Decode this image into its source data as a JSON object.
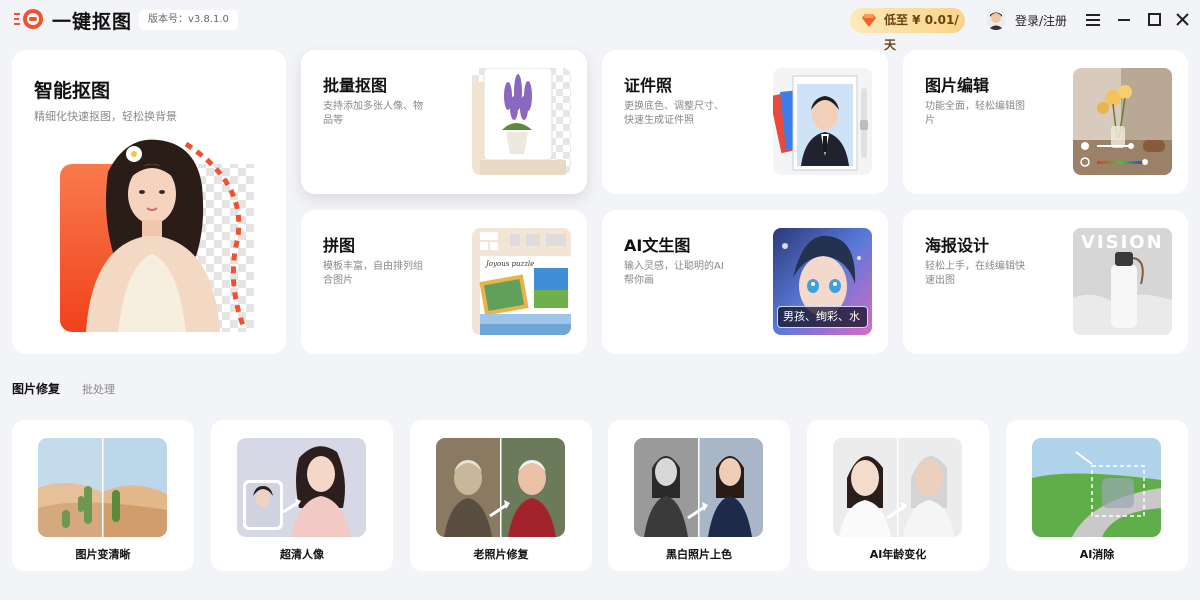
{
  "app": {
    "title": "一键抠图",
    "version": "版本号：v3.8.1.0"
  },
  "header": {
    "promo_label": "低至 ¥ 0.01/天",
    "login_label": "登录/注册"
  },
  "featured": {
    "title": "智能抠图",
    "desc": "精细化快速抠图，轻松换背景"
  },
  "tools": [
    {
      "title": "批量抠图",
      "desc": "支持添加多张人像、物品等"
    },
    {
      "title": "证件照",
      "desc": "更换底色、调整尺寸、快速生成证件照"
    },
    {
      "title": "图片编辑",
      "desc": "功能全面，轻松编辑图片"
    },
    {
      "title": "拼图",
      "desc": "模板丰富，自由排列组合图片"
    },
    {
      "title": "AI文生图",
      "desc": "输入灵感，让聪明的AI帮你画",
      "prompt_example": "男孩、绚彩、水"
    },
    {
      "title": "海报设计",
      "desc": "轻松上手，在线编辑快速出图",
      "poster_text": "VISION"
    }
  ],
  "collage_caption": "Joyous puzzle",
  "section_tabs": {
    "active": "图片修复",
    "inactive": "批处理"
  },
  "repair_tools": [
    {
      "label": "图片变清晰"
    },
    {
      "label": "超清人像"
    },
    {
      "label": "老照片修复"
    },
    {
      "label": "黑白照片上色"
    },
    {
      "label": "AI年龄变化"
    },
    {
      "label": "AI消除"
    }
  ],
  "colors": {
    "background": "#f3f4f7",
    "brand_red": "#f2512f",
    "promo_text": "#6a3f10"
  }
}
